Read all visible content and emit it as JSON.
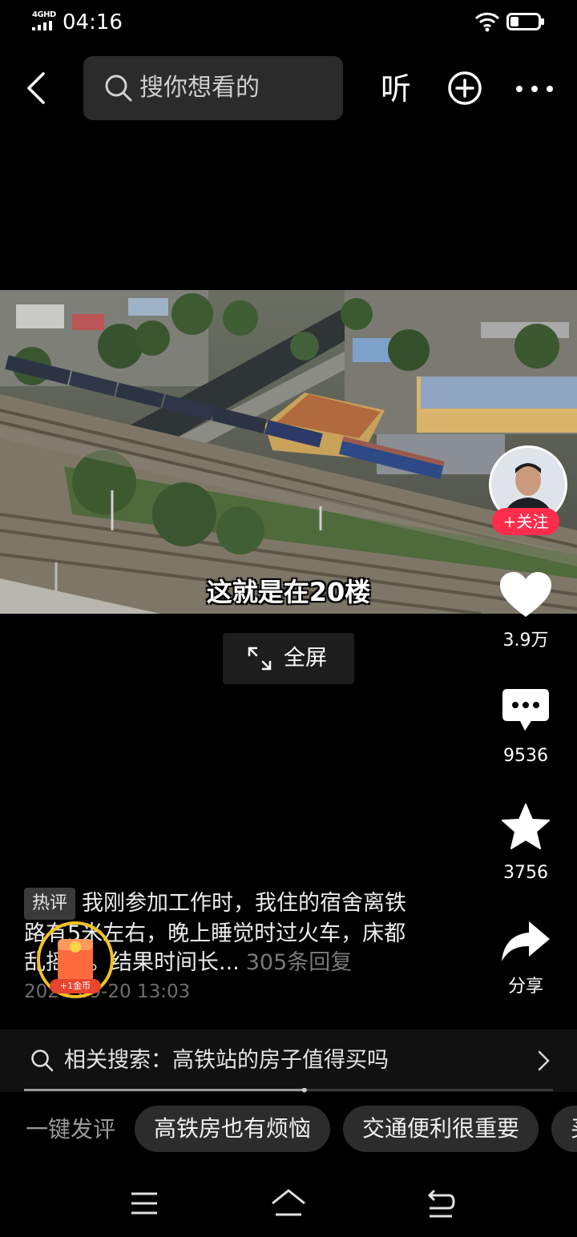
{
  "status_bar": {
    "network": "4GHD",
    "time": "04:16"
  },
  "header": {
    "search_placeholder": "搜你想看的",
    "listen_label": "听"
  },
  "video": {
    "caption": "这就是在20楼",
    "fullscreen_label": "全屏"
  },
  "author": {
    "follow_label": "+关注"
  },
  "actions": {
    "like_count": "3.9万",
    "comment_count": "9536",
    "favorite_count": "3756",
    "share_label": "分享"
  },
  "hot_comment": {
    "badge": "热评",
    "line1": "我刚参加工作时，我住的宿舍离铁",
    "line2": "路有5米左右，晚上睡觉时过火车，床都",
    "line3_text": "乱摇晃。结果时间长...",
    "replies": "305条回复",
    "date": "2024-09-20 13:03",
    "coin_label": "+1金币"
  },
  "related_search": {
    "text": "相关搜索：高铁站的房子值得买吗"
  },
  "quick_comment": {
    "label": "一键发评",
    "chips": [
      "高铁房也有烦恼",
      "交通便利很重要",
      "买"
    ]
  },
  "progress": {
    "played_fraction": 0.53
  },
  "colors": {
    "accent_red": "#ff2d4b",
    "background": "#000000"
  }
}
